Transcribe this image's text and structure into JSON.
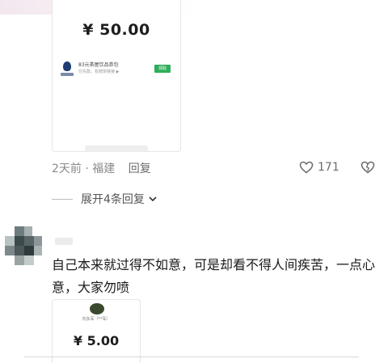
{
  "first_card": {
    "amount": "¥ 50.00",
    "coupon": {
      "title": "83元茶屋饮品券包",
      "description": "付先款，有赠饼链接 ▶",
      "button_label": "领取"
    }
  },
  "meta": {
    "time_location": "2天前 · 福建",
    "reply_label": "回复",
    "like_count": "171"
  },
  "expand": {
    "label": "展开4条回复"
  },
  "second_comment": {
    "text": "自己本来就过得不如意，可是却看不得人间疾苦，一点心意，大家勿喷"
  },
  "second_card": {
    "payee": "刘永军（**军）",
    "amount": "¥ 5.00"
  },
  "colors": {
    "accent_green": "#2fae5a",
    "meta_gray": "#8a8a8a"
  }
}
